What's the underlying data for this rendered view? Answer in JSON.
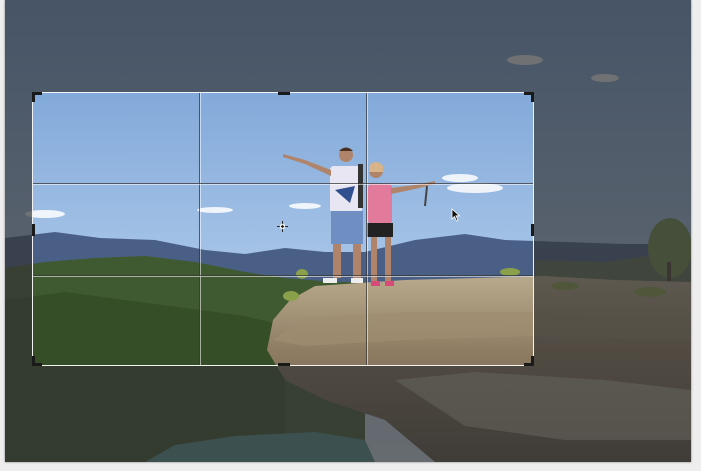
{
  "app": {
    "tool": "crop-tool",
    "mode": "crop-overlay-rule-of-thirds"
  },
  "colors": {
    "sky_top": "#6f9bd3",
    "sky_bottom": "#c4d8ee",
    "mountains": "#4a5f86",
    "hills": "#3d5a2c",
    "rock": "#8a7860",
    "shade": "#343434",
    "crop_border": "#f2f2f2",
    "handle": "#1a1a1a"
  },
  "icons": {
    "center": "crosshair-icon",
    "pointer": "arrow-cursor-icon"
  },
  "crop": {
    "grid": "rule-of-thirds",
    "handles": 8
  }
}
